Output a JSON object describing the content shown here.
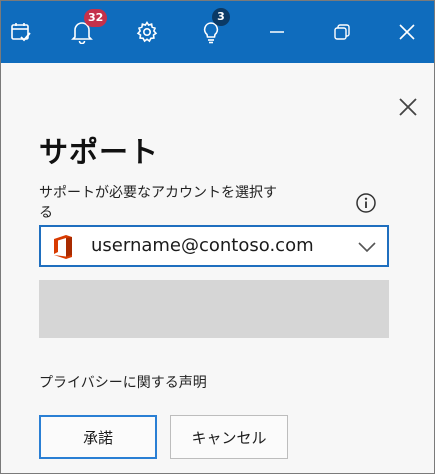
{
  "titlebar": {
    "bg_color": "#0f6cbd",
    "icons": [
      {
        "name": "calendar-check-icon"
      },
      {
        "name": "bell-icon",
        "badge": "32"
      },
      {
        "name": "gear-icon"
      },
      {
        "name": "lightbulb-icon",
        "badge": "3"
      },
      {
        "name": "minimize-icon"
      },
      {
        "name": "restore-icon"
      },
      {
        "name": "close-icon"
      }
    ]
  },
  "panel": {
    "title": "サポート",
    "account_label": "サポートが必要なアカウントを選択する",
    "account_value": "username@contoso.com",
    "privacy_link": "プライバシーに関する声明",
    "accept_button": "承諾",
    "cancel_button": "キャンセル"
  }
}
